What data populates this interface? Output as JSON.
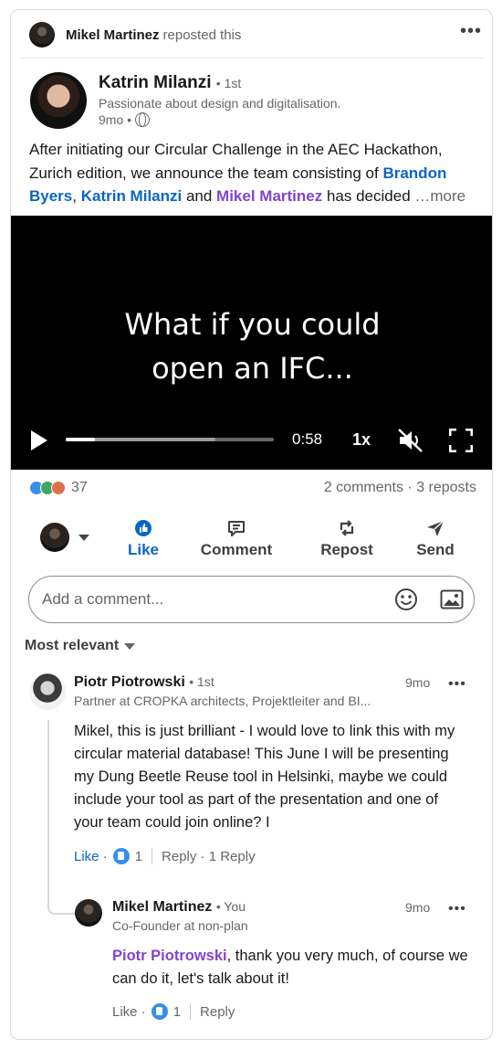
{
  "repost": {
    "name": "Mikel Martinez",
    "suffix": "reposted this"
  },
  "post": {
    "author_name": "Katrin Milanzi",
    "author_degree": "• 1st",
    "author_headline": "Passionate about design and digitalisation.",
    "time": "9mo •",
    "text_1": "After initiating our Circular Challenge in the AEC Hackathon, Zurich edition, we announce the team consisting of ",
    "mention_1": "Brandon Byers",
    "comma": ", ",
    "mention_2": "Katrin Milanzi",
    "text_and": " and ",
    "mention_3": "Mikel Martinez",
    "text_2": " has decided ",
    "more": "…more"
  },
  "video": {
    "caption_line1": "What if you could",
    "caption_line2": "open an IFC...",
    "time": "0:58",
    "speed": "1x",
    "progress_fraction": 0.14,
    "buffered_fraction": 0.72
  },
  "social": {
    "reaction_count": "37",
    "comments_reposts": "2 comments · 3 reposts"
  },
  "actions": {
    "like": "Like",
    "comment": "Comment",
    "repost": "Repost",
    "send": "Send"
  },
  "comment_box": {
    "placeholder": "Add a comment..."
  },
  "sort": {
    "label": "Most relevant"
  },
  "comments": [
    {
      "name": "Piotr Piotrowski",
      "degree": "• 1st",
      "headline": "Partner at CROPKA architects, Projektleiter and BI...",
      "time": "9mo",
      "body": "Mikel, this is just brilliant - I would love to link this with my circular material database! This June I will be presenting my Dung Beetle Reuse tool in Helsinki, maybe we could include your tool as part of the presentation and one of your team could join online? I",
      "like_label": "Like ·",
      "like_count": "1",
      "reply_label": "Reply · 1 Reply"
    },
    {
      "name": "Mikel Martinez",
      "degree": "• You",
      "headline": "Co-Founder at non-plan",
      "time": "9mo",
      "mention": "Piotr Piotrowski",
      "body": ", thank you very much, of course we can do it, let's talk about it!",
      "like_label": "Like ·",
      "like_count": "1",
      "reply_label": "Reply"
    }
  ],
  "colors": {
    "accent": "#0a66c2",
    "mention_purple": "#8344cc",
    "muted": "#666666"
  }
}
